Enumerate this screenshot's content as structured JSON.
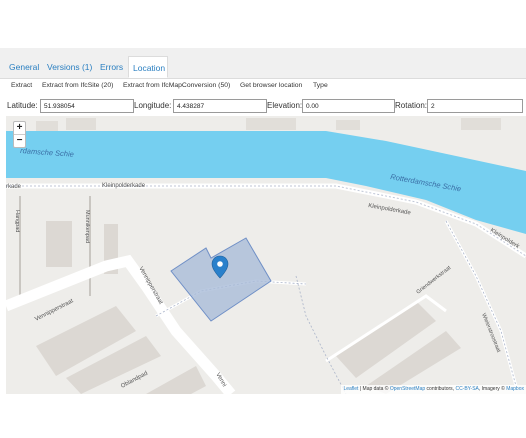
{
  "tabs": [
    {
      "label": "General"
    },
    {
      "label": "Versions (1)"
    },
    {
      "label": "Errors"
    },
    {
      "label": "Location"
    }
  ],
  "actions": [
    {
      "label": "Extract"
    },
    {
      "label": "Extract from IfcSite (20)"
    },
    {
      "label": "Extract from IfcMapConversion (50)"
    },
    {
      "label": "Get browser location"
    },
    {
      "label": "Type"
    }
  ],
  "location": {
    "latitude_label": "Latitude:",
    "latitude_value": "51.938054",
    "longitude_label": "Longitude:",
    "longitude_value": "4.438287",
    "elevation_label": "Elevation:",
    "elevation_value": "0.00",
    "rotation_label": "Rotation:",
    "rotation_value": "2"
  },
  "map": {
    "zoom_in": "+",
    "zoom_out": "−",
    "labels": {
      "water_left": "rdamsche Schie",
      "water_right": "Rotterdamsche Schie",
      "kleinpolderkade_left": "rkade",
      "kleinpolderkade_mid": "Kleinpolderkade",
      "kleinpolderkade_right": "Kleinpolderkade",
      "kleinpolderkade_far": "Kleinpolderk",
      "hangpad": "Hangpad",
      "munnikenpad": "Munnikenpad",
      "vennipperstraat_top": "Vennipperstraat",
      "vennipperstraat_left": "Vennipperstraat",
      "vennipperstraat_bottom": "Venni",
      "oblandpad": "Oblandpad",
      "griendwerkstraat": "Griendwerkstraat",
      "wielstroostraat": "Wielerstroostraat"
    },
    "attribution": {
      "leaflet": "Leaflet",
      "sep1": " | Map data © ",
      "osm": "OpenStreetMap",
      "contributors": " contributors, ",
      "license": "CC-BY-SA",
      "imagery": ", Imagery © ",
      "mapbox": "Mapbox"
    }
  },
  "colors": {
    "accent": "#2a7fc1",
    "water": "#75cff0",
    "parcel": "#a9bcd8",
    "marker": "#2a80cb"
  }
}
